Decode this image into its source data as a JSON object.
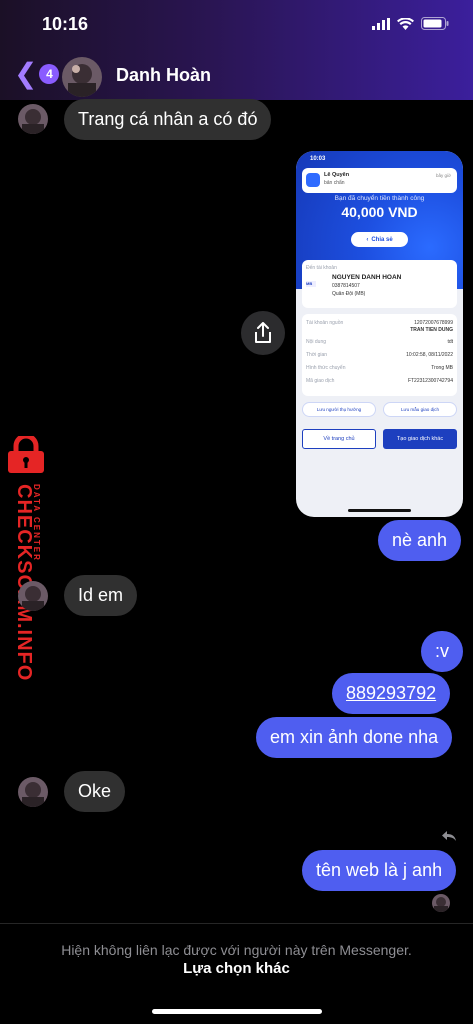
{
  "status_bar": {
    "time": "10:16"
  },
  "header": {
    "back_badge": "4",
    "contact_name": "Danh Hoàn"
  },
  "messages": {
    "m1": "Trang cá nhân a có đó",
    "m2": "nè anh",
    "m3": "Id em",
    "m4": ":v",
    "m5": "889293792",
    "m6": "em xin ảnh done nha",
    "m7": "Oke",
    "m8": "tên web là j anh"
  },
  "receipt": {
    "time": "10:03",
    "toast_name": "Lê Quyên",
    "toast_sub": "bản chẩn",
    "toast_right": "bây giờ",
    "success_text": "Bạn đã chuyển tiền thành công",
    "amount": "40,000 VND",
    "share_label": "Chia sẻ",
    "to_account_label": "Đến tài khoản",
    "recipient_name": "NGUYEN DANH HOAN",
    "recipient_account": "0387814507",
    "recipient_bank": "Quân Đội (MB)",
    "bank_logo": "MB",
    "rows": [
      {
        "label": "Tài khoản nguồn",
        "value": "12072007678999"
      },
      {
        "label": "",
        "value": "TRAN TIEN DUNG"
      },
      {
        "label": "Nội dung",
        "value": "tdt"
      },
      {
        "label": "Thời gian",
        "value": "10:02:58, 08/11/2022"
      },
      {
        "label": "Hình thức chuyển",
        "value": "Trong MB"
      },
      {
        "label": "Mã giao dịch",
        "value": "FT22312300742794"
      }
    ],
    "save_beneficiary": "Lưu người thụ hưởng",
    "save_template": "Lưu mẫu giao dịch",
    "home_button": "Về trang chủ",
    "new_txn_button": "Tạo giao dịch khác"
  },
  "watermark": {
    "main": "CHECKSCAM.INFO",
    "sub": "DATA CENTER"
  },
  "footer": {
    "notice": "Hiện không liên lạc được với người này trên Messenger.",
    "action": "Lựa chọn khác"
  },
  "colors": {
    "outgoing": "#4f5ef0",
    "incoming": "#303030",
    "accent": "#8a5cff",
    "watermark": "#e52525"
  }
}
